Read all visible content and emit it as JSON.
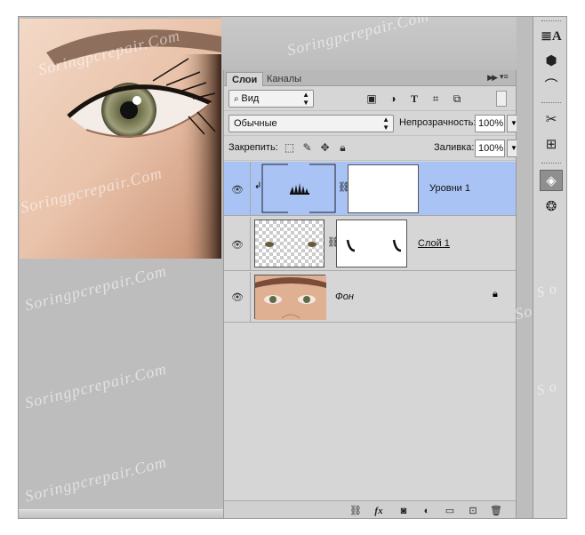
{
  "tabs": {
    "layers": "Слои",
    "channels": "Каналы"
  },
  "filter": {
    "kind_label": "Вид"
  },
  "blend": {
    "mode": "Обычные",
    "opacity_label": "Непрозрачность:",
    "opacity_value": "100%"
  },
  "lock": {
    "label": "Закрепить:",
    "fill_label": "Заливка:",
    "fill_value": "100%"
  },
  "layers": [
    {
      "name": "Уровни 1",
      "selected": true
    },
    {
      "name": "Слой 1",
      "selected": false
    },
    {
      "name": "Фон",
      "selected": false
    }
  ],
  "footer": {
    "fx_label": "fx"
  },
  "watermark": "Soringpcrepair.Com",
  "colors": {
    "selected_row": "#a9c3f5",
    "panel_bg": "#d6d6d6",
    "workspace": "#bdbdbd"
  },
  "icons": {
    "dock": [
      "character-icon",
      "3d-cube-icon",
      "pen-path-icon",
      "tools-icon",
      "properties-icon",
      "layers-icon",
      "channels-icon"
    ]
  }
}
